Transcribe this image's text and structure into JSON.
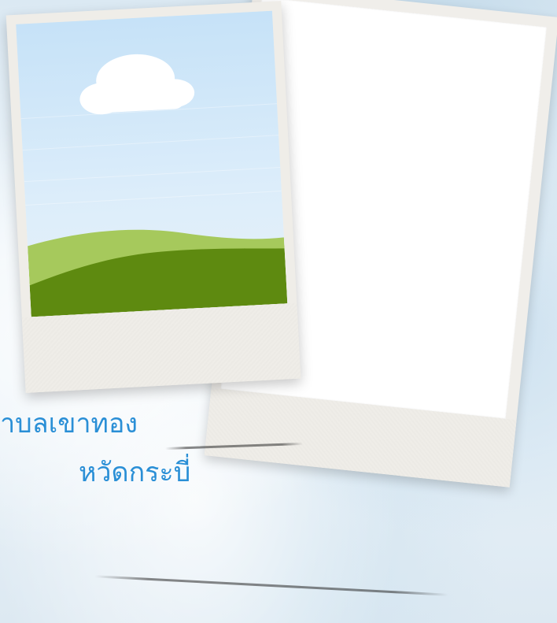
{
  "caption": {
    "line1": "ตำบลเขาทอง",
    "line2": "หวัดกระบี่",
    "color": "#2a8fd6"
  },
  "colors": {
    "sky_top": "#c8e3f8",
    "cloud": "#ffffff",
    "hill_light": "#9fc65a",
    "hill_dark": "#5f8a0f",
    "paper": "#efede8"
  },
  "icons": {
    "cloud": "cloud-icon",
    "landscape": "landscape-illustration"
  }
}
